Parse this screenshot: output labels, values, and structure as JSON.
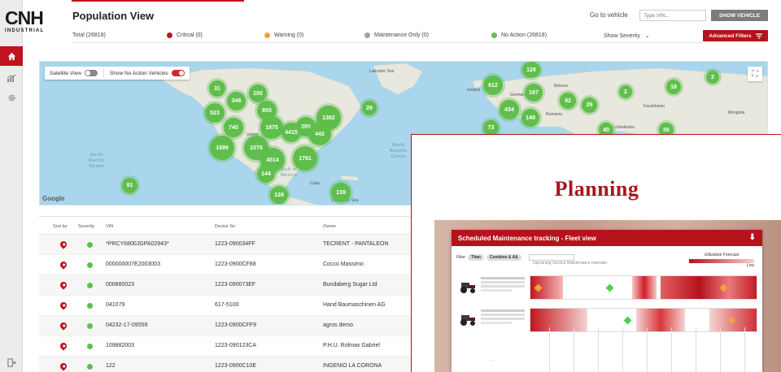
{
  "brand": {
    "name": "CNH",
    "subtitle": "INDUSTRIAL"
  },
  "header": {
    "title": "Population View",
    "goto_label": "Go to vehicle",
    "vin_placeholder": "Type VIN...",
    "show_vehicle_label": "SHOW VEHICLE"
  },
  "status": {
    "total": "Total (26818)",
    "critical": "Critical (0)",
    "warning": "Warning (0)",
    "maintenance": "Maintenance Only (0)",
    "no_action": "No Action (26818)",
    "show_severity": "Show Severity",
    "advanced_filters": "Advanced Filters",
    "colors": {
      "critical": "#c1121f",
      "warning": "#f0a23a",
      "maintenance": "#a0a0a0",
      "no_action": "#5fbe4c"
    }
  },
  "sidebar": {
    "items": [
      {
        "icon": "home-icon",
        "active": true
      },
      {
        "icon": "chart-icon",
        "active": false
      },
      {
        "icon": "gear-icon",
        "active": false
      },
      {
        "icon": "logout-icon",
        "active": false
      }
    ]
  },
  "map": {
    "satellite_label": "Satellite View",
    "no_action_label": "Show No Action Vehicles",
    "google": "Google",
    "oceans": {
      "north_pacific": "North\nPacific\nOcean",
      "north_atlantic": "North\nAtlantic\nOcean",
      "gulf": "Gulf of\nMexico"
    },
    "places": {
      "labrador": "Labrador Sea",
      "iceland": "Iceland",
      "germany": "Germany",
      "belarus": "Belarus",
      "romania": "Romania",
      "kazakhstan": "Kazakhstan",
      "mongolia": "Mongolia",
      "uzbekistan": "Uzbekistan",
      "united": "United",
      "cuba": "Cuba",
      "caribbean": "Caribbean Sea"
    },
    "clusters": [
      "31",
      "100",
      "346",
      "523",
      "855",
      "740",
      "1875",
      "1382",
      "26",
      "209",
      "4415",
      "442",
      "1699",
      "1070",
      "4514",
      "1761",
      "144",
      "128",
      "139",
      "91",
      "126",
      "612",
      "197",
      "434",
      "92",
      "29",
      "149",
      "73",
      "18",
      "2",
      "2",
      "40",
      "50"
    ]
  },
  "table": {
    "headers": {
      "sort": "Sort by:",
      "severity": "Severity",
      "vin": "VIN",
      "device": "Device Sn",
      "owner": "Owner"
    },
    "rows": [
      {
        "vin": "*PRCY6800JGPA02943*",
        "device": "1223-090034FF",
        "owner": "TECRENT - PANTALEON"
      },
      {
        "vin": "000000007E2003003",
        "device": "1223-0900CF88",
        "owner": "Cocco Massimo"
      },
      {
        "vin": "000880023",
        "device": "1223-090073EF",
        "owner": "Bundaberg Sugar Ltd"
      },
      {
        "vin": "041079",
        "device": "617-5100",
        "owner": "Hand Baumaschinen AG"
      },
      {
        "vin": "04232-17-09559",
        "device": "1223-0900CFF9",
        "owner": "agros demo"
      },
      {
        "vin": "109882003",
        "device": "1223-090123CA",
        "owner": "P.H.U. Rolmax Gabriel"
      },
      {
        "vin": "122",
        "device": "1223-0900C10E",
        "owner": "INGENIO LA CORONA"
      }
    ]
  },
  "planning": {
    "title": "Planning",
    "window_title": "Scheduled Maintenance tracking - Fleet view",
    "filter_label": "Filter",
    "chip1": "Titan",
    "chip2": "Combine & A&",
    "legend_title": "Utilization Forecast",
    "legend_low": "Low",
    "subtitle": "Upcoming Service Maintenance Intervals",
    "more": "..."
  }
}
